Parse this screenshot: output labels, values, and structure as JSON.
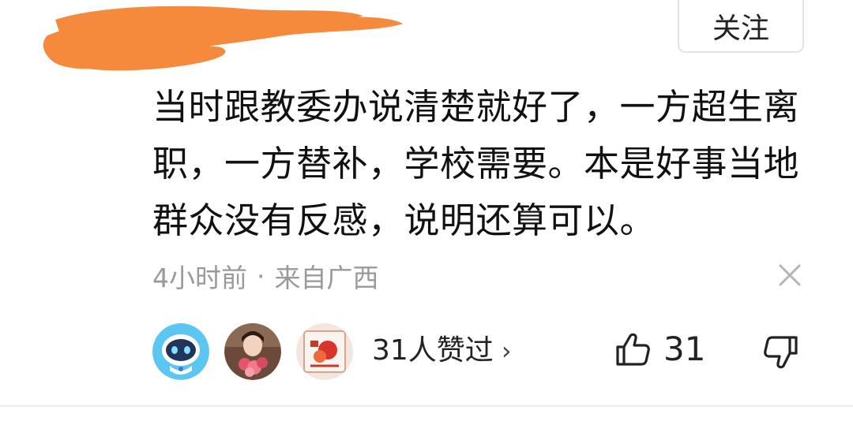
{
  "header": {
    "follow_label": "关注"
  },
  "comment": {
    "text": "当时跟教委办说清楚就好了，一方超生离职，一方替补，学校需要。本是好事当地群众没有反感，说明还算可以。",
    "time": "4小时前",
    "separator": "·",
    "location": "来自广西"
  },
  "likes": {
    "summary": "31人赞过",
    "chevron": "›",
    "count": "31"
  },
  "icons": {
    "close": "close-icon",
    "thumb_up": "thumbs-up-icon",
    "thumb_down": "thumbs-down-icon",
    "chevron": "chevron-right-icon"
  },
  "colors": {
    "redaction": "#f58a3c",
    "meta_text": "#9a9a9a",
    "primary_text": "#111111"
  }
}
